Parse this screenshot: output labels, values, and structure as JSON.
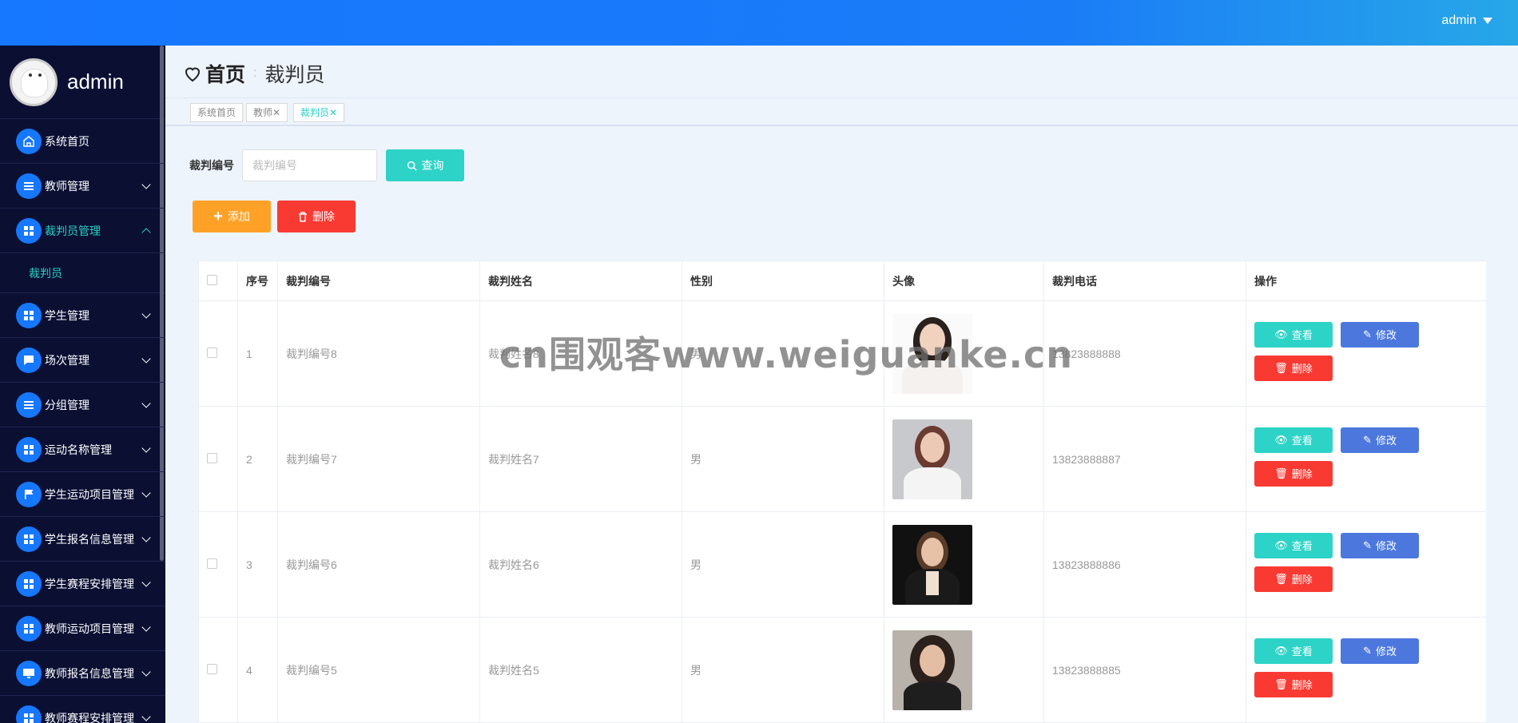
{
  "header": {
    "user": "admin"
  },
  "sidebar": {
    "profile_name": "admin",
    "items": [
      {
        "label": "系统首页",
        "icon": "home-icon",
        "expandable": false
      },
      {
        "label": "教师管理",
        "icon": "list-icon",
        "expandable": true
      },
      {
        "label": "裁判员管理",
        "icon": "grid-icon",
        "expandable": true,
        "active": true,
        "children": [
          "裁判员"
        ]
      },
      {
        "label": "学生管理",
        "icon": "grid-icon",
        "expandable": true
      },
      {
        "label": "场次管理",
        "icon": "chat-icon",
        "expandable": true
      },
      {
        "label": "分组管理",
        "icon": "list-icon",
        "expandable": true
      },
      {
        "label": "运动名称管理",
        "icon": "grid-icon",
        "expandable": true
      },
      {
        "label": "学生运动项目管理",
        "icon": "flag-icon",
        "expandable": true
      },
      {
        "label": "学生报名信息管理",
        "icon": "grid-icon",
        "expandable": true
      },
      {
        "label": "学生赛程安排管理",
        "icon": "grid-icon",
        "expandable": true
      },
      {
        "label": "教师运动项目管理",
        "icon": "grid-icon",
        "expandable": true
      },
      {
        "label": "教师报名信息管理",
        "icon": "monitor-icon",
        "expandable": true
      },
      {
        "label": "教师赛程安排管理",
        "icon": "grid-icon",
        "expandable": true
      }
    ]
  },
  "breadcrumb": {
    "home": "首页",
    "separator": ":",
    "current": "裁判员"
  },
  "tabs": [
    {
      "label": "系统首页",
      "closable": false
    },
    {
      "label": "教师",
      "closable": true
    },
    {
      "label": "裁判员",
      "closable": true,
      "active": true
    }
  ],
  "search": {
    "label": "裁判编号",
    "placeholder": "裁判编号",
    "query_label": "查询"
  },
  "actions": {
    "add_label": "添加",
    "delete_label": "删除"
  },
  "table": {
    "headers": [
      "序号",
      "裁判编号",
      "裁判姓名",
      "性别",
      "头像",
      "裁判电话",
      "操作"
    ],
    "op_labels": {
      "view": "查看",
      "edit": "修改",
      "delete": "删除"
    },
    "rows": [
      {
        "index": "1",
        "code": "裁判编号8",
        "name": "裁判姓名8",
        "gender": "男",
        "phone": "13823888888"
      },
      {
        "index": "2",
        "code": "裁判编号7",
        "name": "裁判姓名7",
        "gender": "男",
        "phone": "13823888887"
      },
      {
        "index": "3",
        "code": "裁判编号6",
        "name": "裁判姓名6",
        "gender": "男",
        "phone": "13823888886"
      },
      {
        "index": "4",
        "code": "裁判编号5",
        "name": "裁判姓名5",
        "gender": "男",
        "phone": "13823888885"
      }
    ]
  },
  "watermark": "cn围观客www.weiguanke.cn",
  "colors": {
    "topbar": "#1677ff",
    "sidebar": "#0b1033",
    "accent": "#2dd3c7",
    "edit": "#4c78de",
    "danger": "#f93a33",
    "add": "#ffa127"
  }
}
